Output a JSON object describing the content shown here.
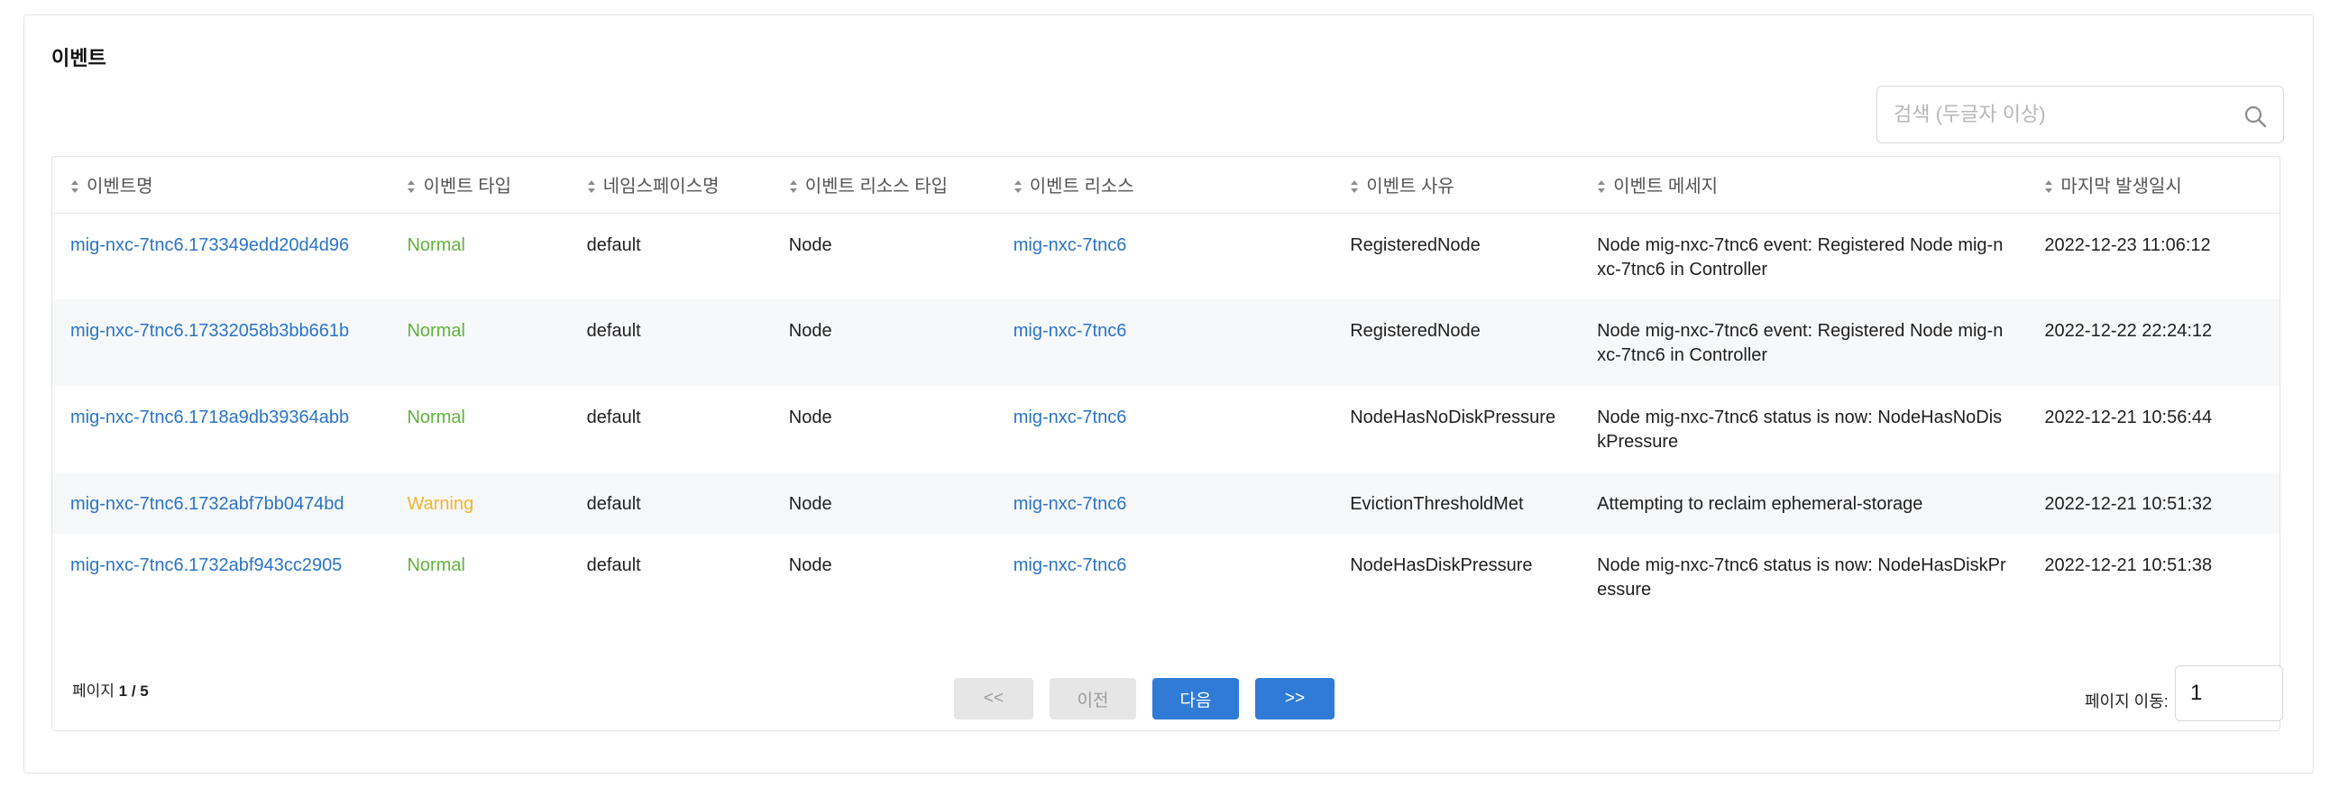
{
  "panel": {
    "title": "이벤트"
  },
  "search": {
    "placeholder": "검색 (두글자 이상)",
    "value": "",
    "icon": "search-icon"
  },
  "table": {
    "columns": [
      "이벤트명",
      "이벤트 타입",
      "네임스페이스명",
      "이벤트 리소스 타입",
      "이벤트 리소스",
      "이벤트 사유",
      "이벤트 메세지",
      "마지막 발생일시"
    ],
    "rows": [
      {
        "name": "mig-nxc-7tnc6.173349edd20d4d96",
        "type": "Normal",
        "namespace": "default",
        "resource_type": "Node",
        "resource": "mig-nxc-7tnc6",
        "reason": "RegisteredNode",
        "message": "Node mig-nxc-7tnc6 event: Registered Node mig-nxc-7tnc6 in Controller",
        "last_seen": "2022-12-23 11:06:12"
      },
      {
        "name": "mig-nxc-7tnc6.17332058b3bb661b",
        "type": "Normal",
        "namespace": "default",
        "resource_type": "Node",
        "resource": "mig-nxc-7tnc6",
        "reason": "RegisteredNode",
        "message": "Node mig-nxc-7tnc6 event: Registered Node mig-nxc-7tnc6 in Controller",
        "last_seen": "2022-12-22 22:24:12"
      },
      {
        "name": "mig-nxc-7tnc6.1718a9db39364abb",
        "type": "Normal",
        "namespace": "default",
        "resource_type": "Node",
        "resource": "mig-nxc-7tnc6",
        "reason": "NodeHasNoDiskPressure",
        "message": "Node mig-nxc-7tnc6 status is now: NodeHasNoDiskPressure",
        "last_seen": "2022-12-21 10:56:44"
      },
      {
        "name": "mig-nxc-7tnc6.1732abf7bb0474bd",
        "type": "Warning",
        "namespace": "default",
        "resource_type": "Node",
        "resource": "mig-nxc-7tnc6",
        "reason": "EvictionThresholdMet",
        "message": "Attempting to reclaim ephemeral-storage",
        "last_seen": "2022-12-21 10:51:32"
      },
      {
        "name": "mig-nxc-7tnc6.1732abf943cc2905",
        "type": "Normal",
        "namespace": "default",
        "resource_type": "Node",
        "resource": "mig-nxc-7tnc6",
        "reason": "NodeHasDiskPressure",
        "message": "Node mig-nxc-7tnc6 status is now: NodeHasDiskPressure",
        "last_seen": "2022-12-21 10:51:38"
      }
    ]
  },
  "pagination": {
    "page_label": "페이지",
    "page_value": "1 / 5",
    "first_label": "<<",
    "prev_label": "이전",
    "next_label": "다음",
    "last_label": ">>",
    "goto_label": "페이지 이동:",
    "goto_value": "1"
  },
  "colors": {
    "link": "#2a74c8",
    "normal": "#61b33b",
    "warning": "#f2b530",
    "primary_button": "#2f7bd6",
    "disabled_button": "#e6e6e6"
  }
}
